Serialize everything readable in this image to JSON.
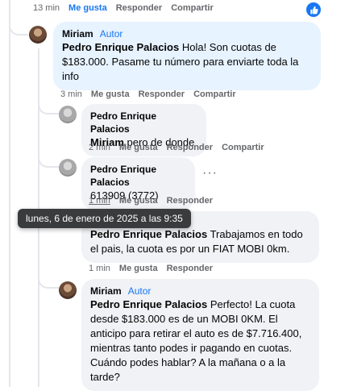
{
  "top_meta": {
    "time": "13 min",
    "like": "Me gusta",
    "reply": "Responder",
    "share": "Compartir"
  },
  "comments": [
    {
      "author": "Miriam",
      "badge": "Autor",
      "mention": "Pedro Enrique Palacios",
      "text": " Hola! Son cuotas de $183.000. Pasame tu número para enviarte toda la info",
      "time": "3 min",
      "like": "Me gusta",
      "reply": "Responder",
      "share": "Compartir"
    },
    {
      "author": "Pedro Enrique Palacios",
      "mention": "Miriam",
      "text": " pero de donde",
      "time": "2 min",
      "like": "Me gusta",
      "reply": "Responder",
      "share": "Compartir"
    },
    {
      "author": "Pedro Enrique Palacios",
      "text": "613909 (3772)",
      "time": "1 min",
      "like": "Me gusta",
      "reply": "Responder"
    },
    {
      "mention": "Pedro Enrique Palacios",
      "text": " Trabajamos en todo el pais, la cuota es por un FIAT MOBI 0km.",
      "time": "1 min",
      "like": "Me gusta",
      "reply": "Responder"
    },
    {
      "author": "Miriam",
      "badge": "Autor",
      "mention": "Pedro Enrique Palacios",
      "text": " Perfecto! La cuota desde $183.000 es de un MOBI 0KM. El anticipo para retirar el auto es de $7.716.400, mientras tanto podes ir pagando en cuotas. Cuándo podes hablar? A la mañana o a la tarde?"
    }
  ],
  "tooltip": "lunes, 6 de enero de 2025 a las 9:35",
  "colors": {
    "accent": "#1877f2",
    "bubble": "#f0f2f5",
    "highlight": "#e7f3ff",
    "meta": "#65676b"
  },
  "icons": {
    "like_reaction": "thumbs-up-icon",
    "more": "more-options-icon"
  }
}
